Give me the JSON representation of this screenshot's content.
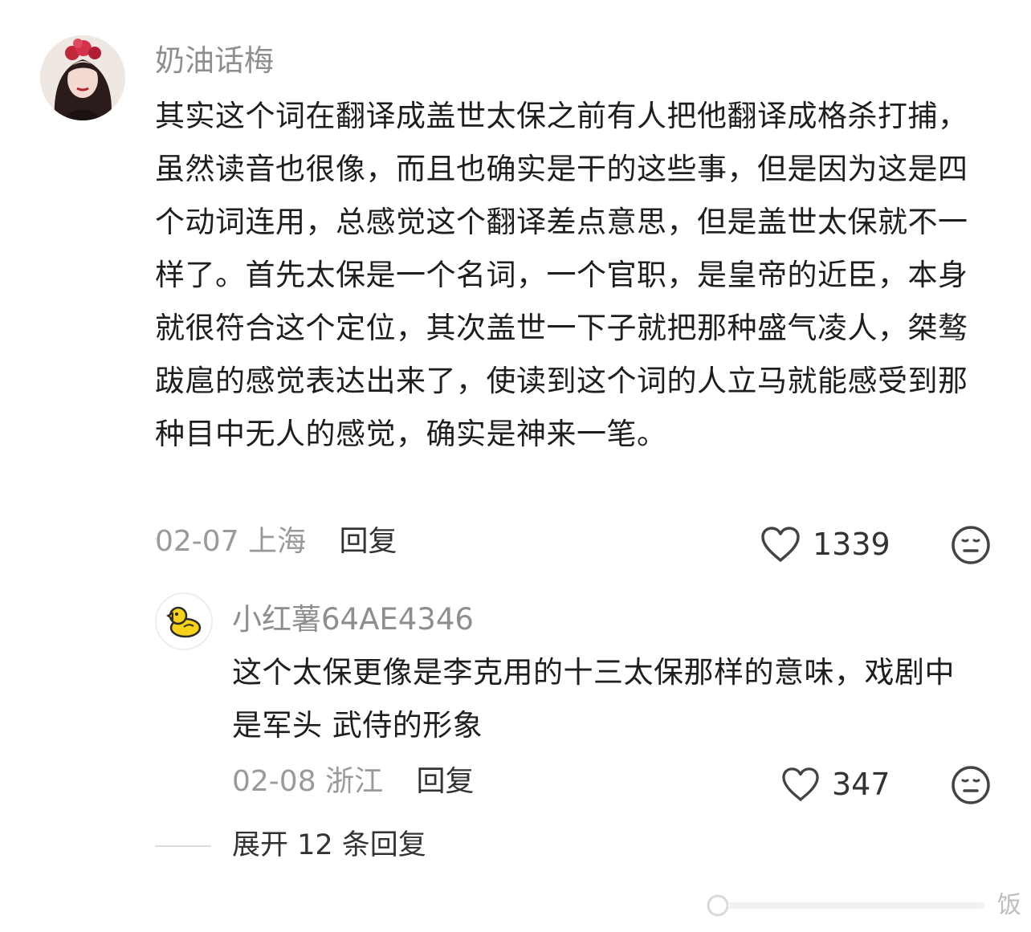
{
  "comment": {
    "username": "奶油话梅",
    "text": "其实这个词在翻译成盖世太保之前有人把他翻译成格杀打捕，虽然读音也很像，而且也确实是干的这些事，但是因为这是四个动词连用，总感觉这个翻译差点意思，但是盖世太保就不一样了。首先太保是一个名词，一个官职，是皇帝的近臣，本身就很符合这个定位，其次盖世一下子就把那种盛气凌人，桀骜跋扈的感觉表达出来了，使读到这个词的人立马就能感受到那种目中无人的感觉，确实是神来一笔。",
    "date": "02-07",
    "location": "上海",
    "reply_label": "回复",
    "likes": "1339"
  },
  "reply": {
    "username": "小红薯64AE4346",
    "text": "这个太保更像是李克用的十三太保那样的意味，戏剧中是军头 武侍的形象",
    "date": "02-08",
    "location": "浙江",
    "reply_label": "回复",
    "likes": "347"
  },
  "expand_label": "展开 12 条回复",
  "watermark": "饭",
  "icons": {
    "like": "heart-outline-icon",
    "dislike": "neutral-face-icon",
    "reply_avatar": "yellow-duck-icon"
  },
  "colors": {
    "username": "#8e8e8e",
    "meta": "#9a9a9a",
    "text": "#1e1e1e",
    "duck": "#f7d21a"
  }
}
